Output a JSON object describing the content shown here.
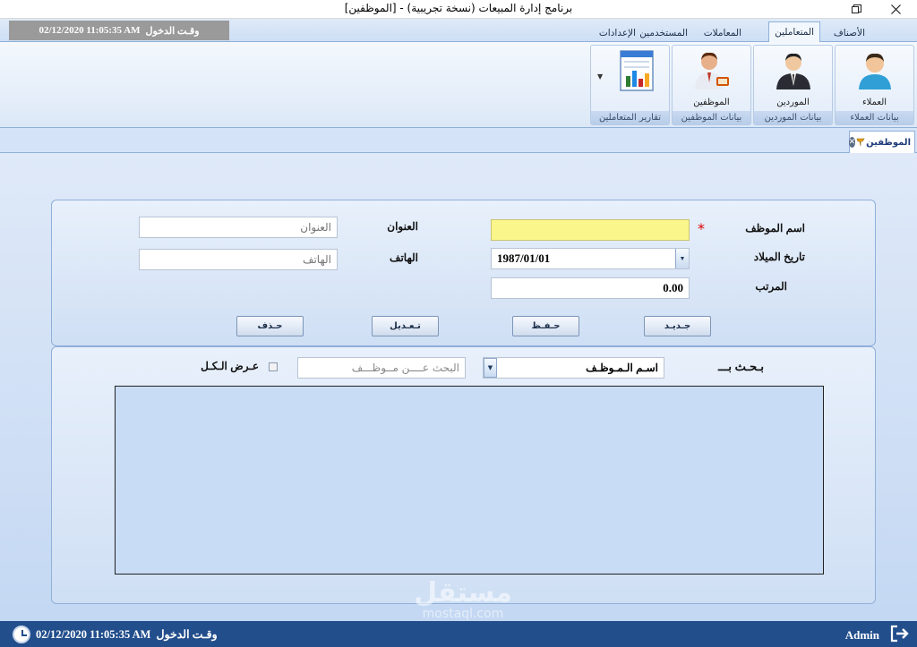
{
  "window": {
    "title": "برنامج إدارة المبيعات (نسخة تجريبية) - [الموظفين]"
  },
  "login_box": {
    "label": "وقـت الدخول",
    "datetime": "02/12/2020 11:05:35 AM"
  },
  "ribbon_tabs": [
    "الأصناف",
    "المتعاملين",
    "المعاملات",
    "المستخدمين",
    "الإعدادات"
  ],
  "ribbon_active_tab": "المتعاملين",
  "ribbon_groups": [
    {
      "button": "العملاء",
      "group": "بيانات العملاء",
      "icon": "customer-icon"
    },
    {
      "button": "الموردين",
      "group": "بيانات الموردين",
      "icon": "supplier-icon"
    },
    {
      "button": "الموظفين",
      "group": "بيانات الموظفين",
      "icon": "employee-icon"
    },
    {
      "button": "",
      "group": "تقارير المتعاملين",
      "icon": "report-chart-icon"
    }
  ],
  "doc_tab": {
    "label": "الموظفين"
  },
  "form": {
    "employee_name_label": "اسم الموظف",
    "employee_name_value": "",
    "birthdate_label": "تاريخ الميلاد",
    "birthdate_value": "1987/01/01",
    "salary_label": "المرتب",
    "salary_value": "0.00",
    "address_label": "العنوان",
    "address_placeholder": "العنوان",
    "phone_label": "الهاتف",
    "phone_placeholder": "الهاتف",
    "required_mark": "*"
  },
  "buttons": {
    "new": "جـديـد",
    "save": "حـفـظ",
    "edit": "تـعـديل",
    "delete": "حـذف"
  },
  "search": {
    "label": "بـحـث بـــ",
    "field_value": "اسـم الـمـوظـف",
    "placeholder": "البحث عــــن مــوظـــف",
    "show_all_label": "عـرض الـكـل",
    "show_all_checked": false
  },
  "statusbar": {
    "login_label": "وقـت الدخول",
    "datetime": "02/12/2020 11:05:35 AM",
    "user": "Admin"
  },
  "watermark": {
    "line1": "مستقل",
    "line2": "mostaql.com"
  },
  "colors": {
    "statusbar": "#224e8c",
    "required_field": "#fbf68c",
    "login_box": "#9a9a9a"
  }
}
